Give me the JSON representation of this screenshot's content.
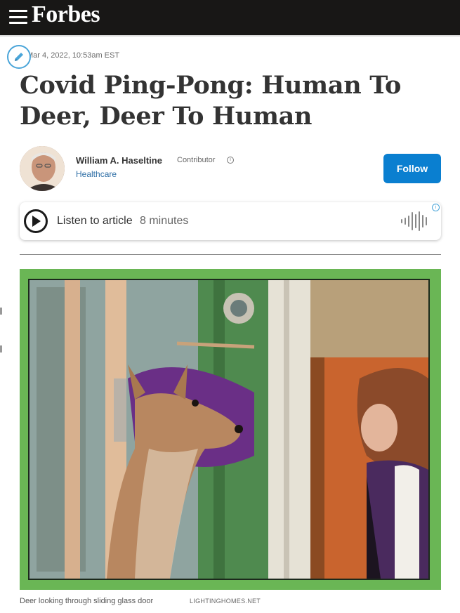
{
  "header": {
    "logo": "Forbes",
    "menu_icon": "hamburger-menu-icon"
  },
  "article": {
    "dateline": "Mar 4, 2022, 10:53am EST",
    "headline": "Covid Ping-Pong: Human To Deer, Deer To Human",
    "author": {
      "name": "William A. Haseltine",
      "role": "Contributor",
      "topic": "Healthcare",
      "follow_label": "Follow"
    },
    "audio": {
      "label": "Listen to article",
      "duration": "8 minutes"
    },
    "image": {
      "caption": "Deer looking through sliding glass door",
      "credit": "LIGHTINGHOMES.NET"
    }
  },
  "colors": {
    "topbar": "#181716",
    "follow_button": "#0a7fd0",
    "topic_link": "#2f6fa6",
    "photo_frame": "#6ab655"
  }
}
